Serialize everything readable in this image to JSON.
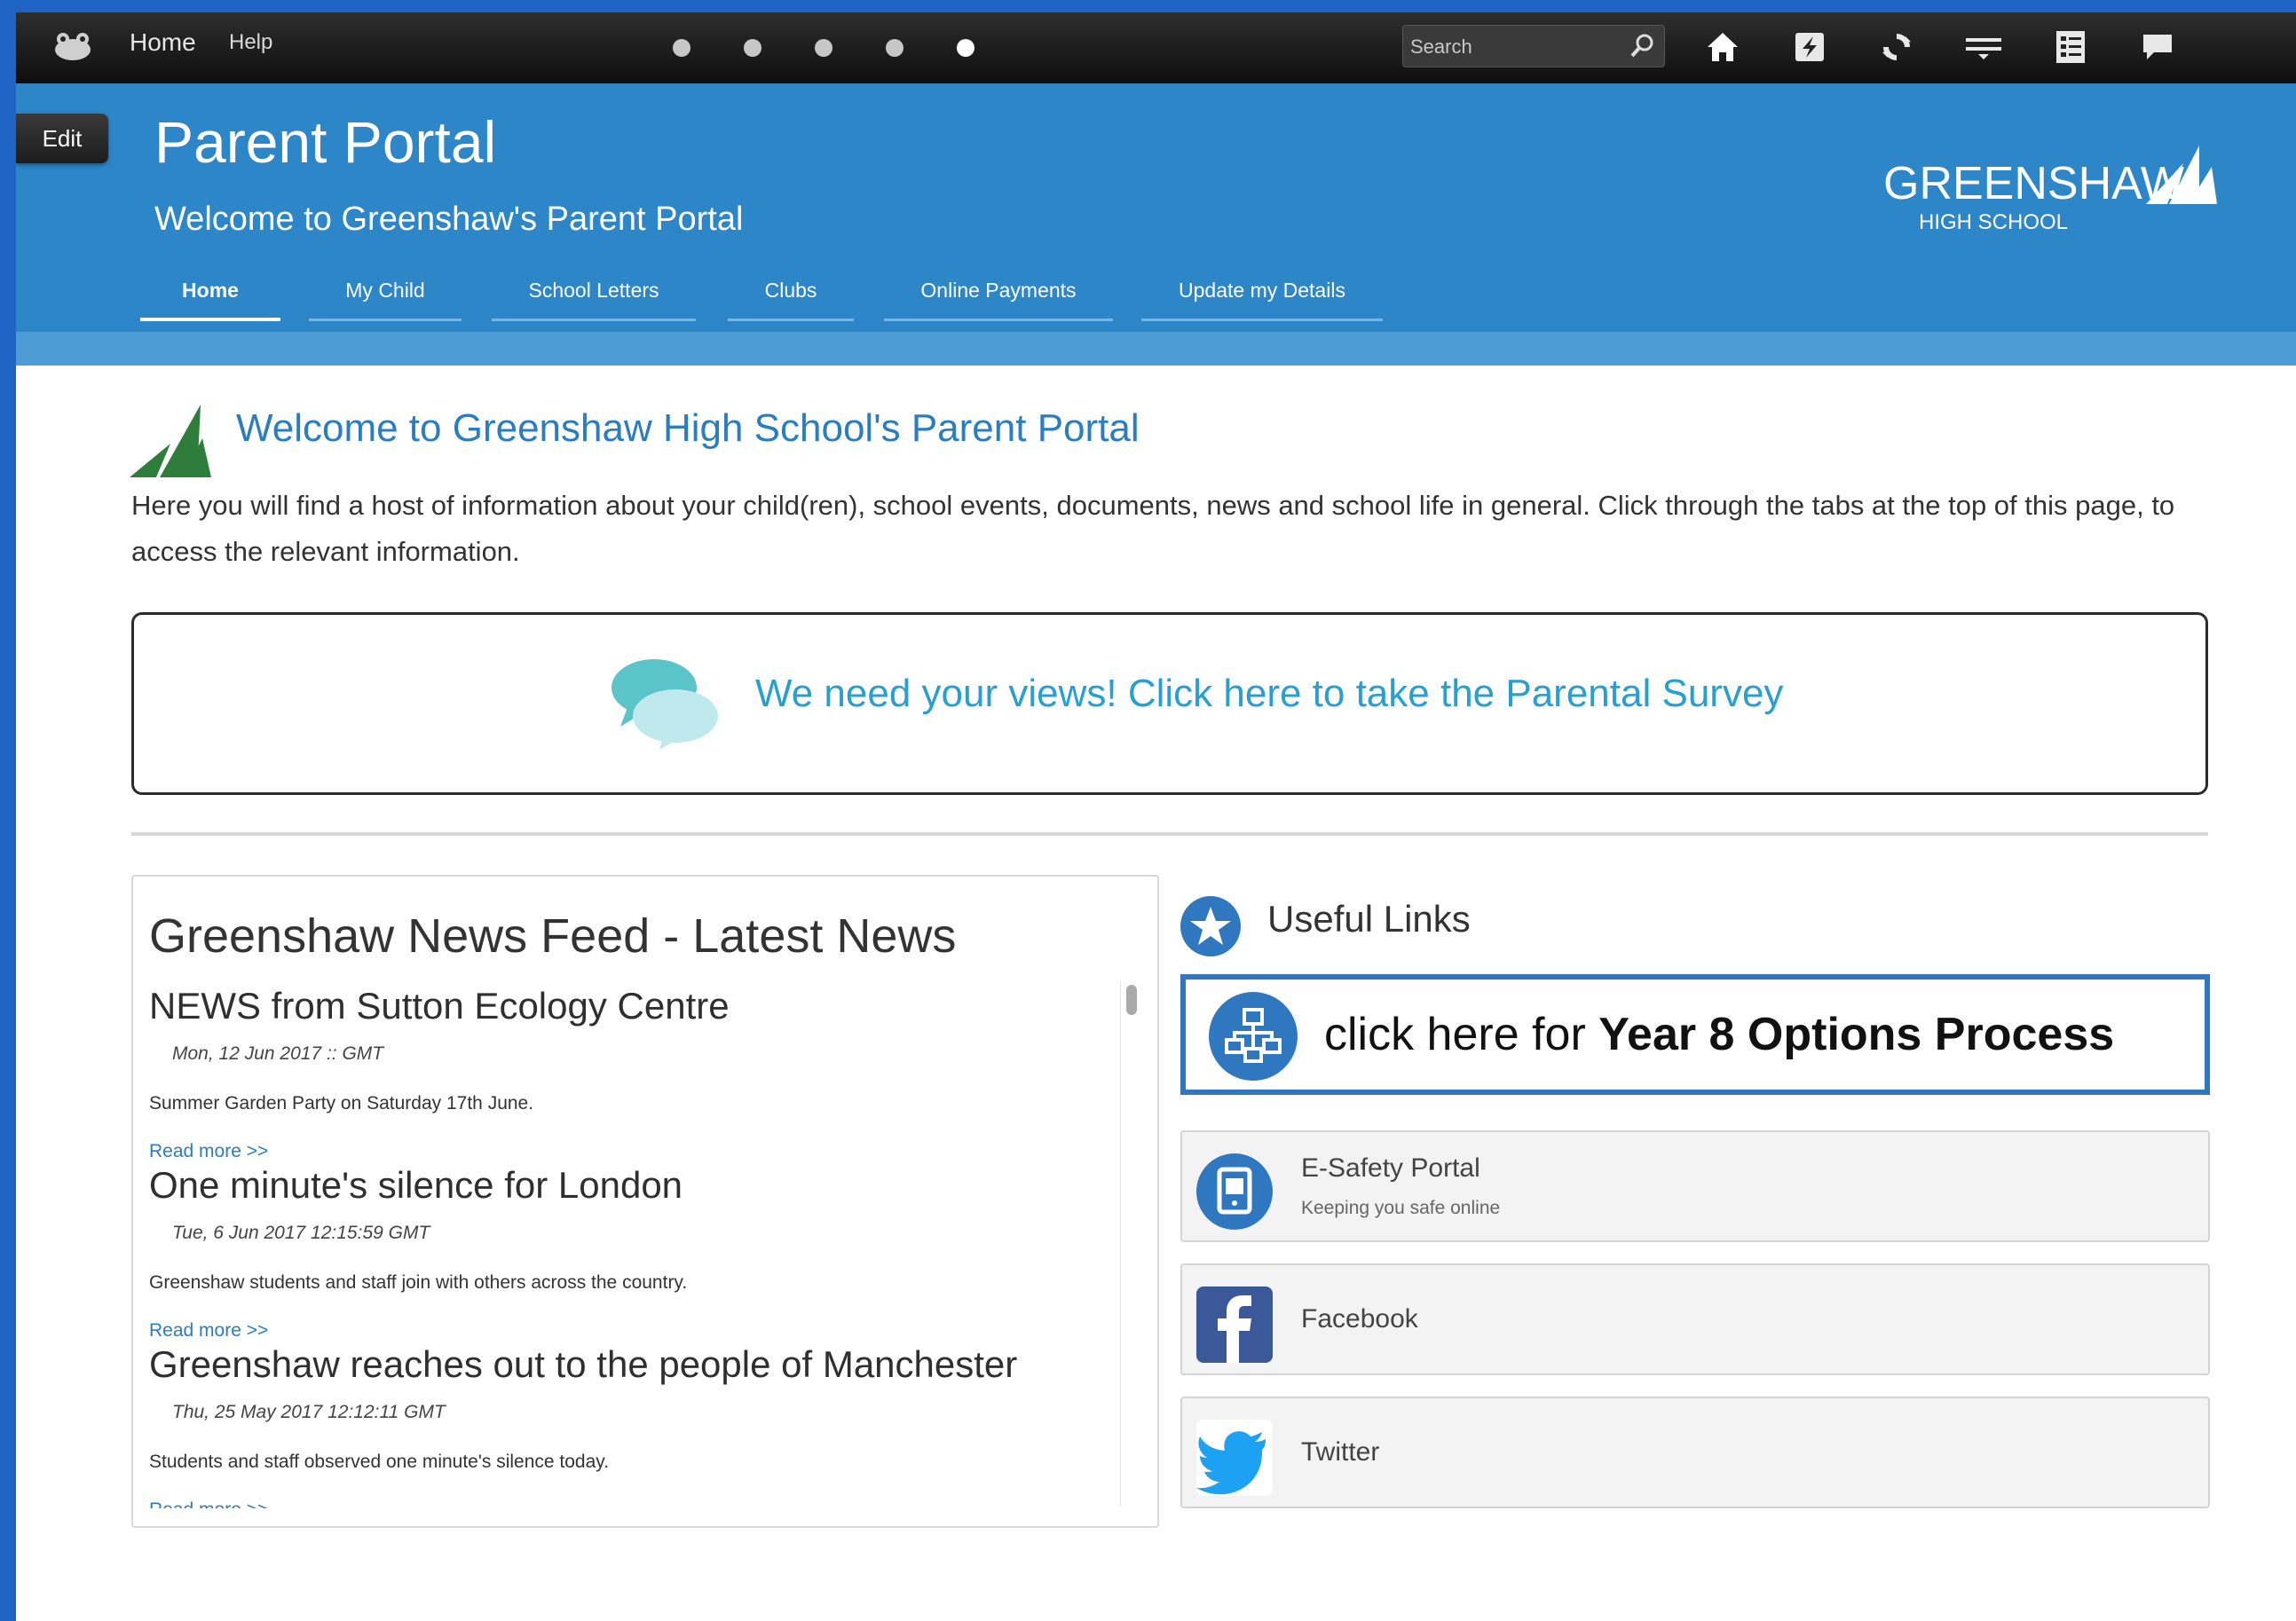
{
  "topbar": {
    "home_label": "Home",
    "help_label": "Help",
    "carousel_dots": 5,
    "active_dot_index": 4,
    "search_placeholder": "Search",
    "icons": [
      "home-icon",
      "transfer-icon",
      "sync-icon",
      "menu-bar-icon",
      "list-icon",
      "chat-icon"
    ]
  },
  "header": {
    "edit_label": "Edit",
    "title": "Parent Portal",
    "subtitle": "Welcome to Greenshaw's Parent Portal",
    "logo_main": "GREENSHAW",
    "logo_sub": "HIGH SCHOOL",
    "nav": [
      {
        "label": "Home",
        "active": true
      },
      {
        "label": "My Child",
        "active": false
      },
      {
        "label": "School Letters",
        "active": false
      },
      {
        "label": "Clubs",
        "active": false
      },
      {
        "label": "Online Payments",
        "active": false
      },
      {
        "label": "Update my Details",
        "active": false
      }
    ]
  },
  "welcome": {
    "heading": "Welcome to Greenshaw High School's Parent Portal",
    "intro": "Here you will find a host of information about your child(ren), school events, documents, news and school life in general. Click through the tabs at the top of this page, to access the relevant information."
  },
  "survey": {
    "text": "We need your views! Click here to take the Parental Survey"
  },
  "news": {
    "title": "Greenshaw News Feed - Latest News",
    "read_more": "Read more >>",
    "items": [
      {
        "headline": "NEWS from Sutton Ecology Centre",
        "date": "Mon, 12 Jun 2017 :: GMT",
        "body": "Summer Garden Party on Saturday 17th June."
      },
      {
        "headline": "One minute's silence for London",
        "date": "Tue, 6 Jun 2017 12:15:59 GMT",
        "body": "Greenshaw students and staff join with others across the country."
      },
      {
        "headline": "Greenshaw reaches out to the people of Manchester",
        "date": "Thu, 25 May 2017 12:12:11 GMT",
        "body": "Students and staff observed one minute's silence today."
      }
    ]
  },
  "links": {
    "title": "Useful Links",
    "options_prefix": "click here for ",
    "options_bold": "Year 8 Options Process",
    "cards": [
      {
        "title": "E-Safety Portal",
        "subtitle": "Keeping you safe online",
        "icon": "tablet-icon"
      },
      {
        "title": "Facebook",
        "subtitle": "",
        "icon": "facebook-icon"
      },
      {
        "title": "Twitter",
        "subtitle": "",
        "icon": "twitter-icon"
      }
    ]
  },
  "colors": {
    "header_blue": "#2d86c8",
    "link_blue": "#2a7dbf",
    "survey_teal": "#27a0cf",
    "options_border": "#2f78bf",
    "facebook": "#3b5998",
    "twitter": "#1da1f2"
  }
}
